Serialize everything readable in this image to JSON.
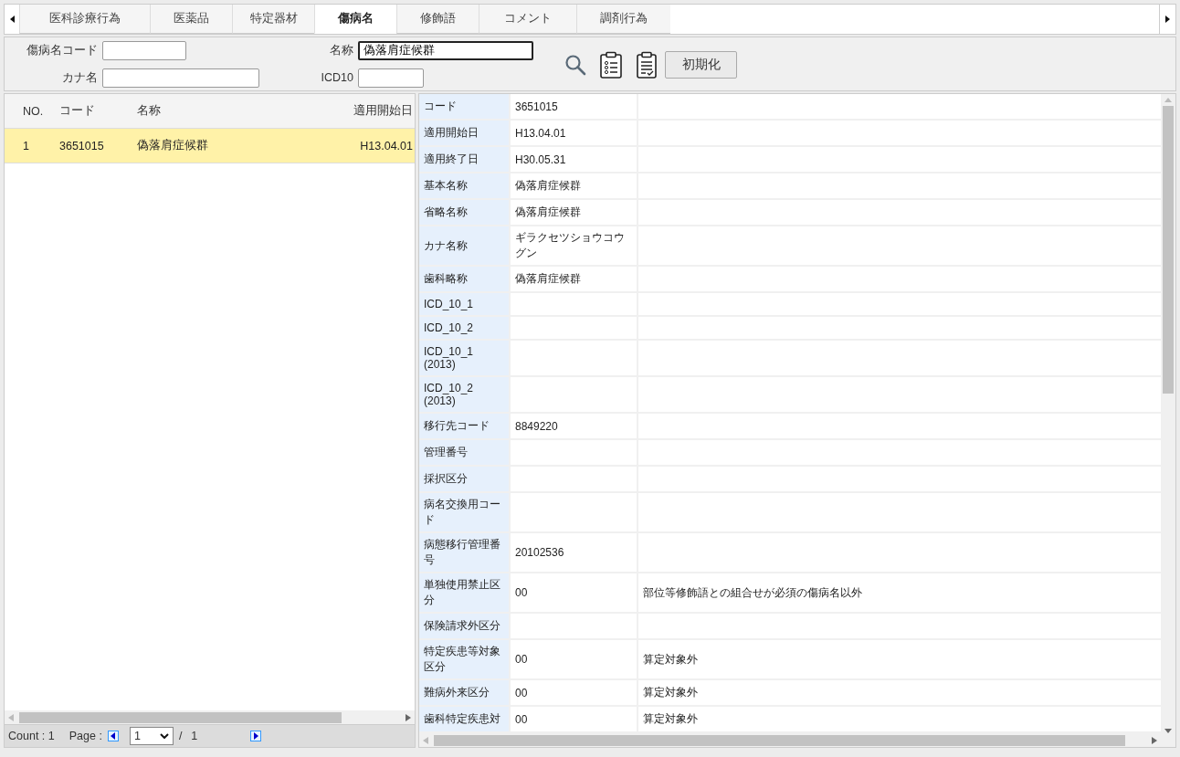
{
  "tabs": [
    {
      "label": "医科診療行為",
      "selected": false
    },
    {
      "label": "医薬品",
      "selected": false
    },
    {
      "label": "特定器材",
      "selected": false
    },
    {
      "label": "傷病名",
      "selected": true
    },
    {
      "label": "修飾語",
      "selected": false
    },
    {
      "label": "コメント",
      "selected": false
    },
    {
      "label": "調剤行為",
      "selected": false
    }
  ],
  "filters": [
    {
      "label": "傷病名コード",
      "focused": false
    },
    {
      "label": "名称",
      "value": "偽落肩症候群",
      "focused": true
    },
    {
      "label": "カナ名",
      "focused": false
    },
    {
      "label": "ICD10",
      "focused": false
    }
  ],
  "reset_button": "初期化",
  "list": {
    "columns": [
      "NO.",
      "コード",
      "名称",
      "適用開始日"
    ],
    "rows": [
      {
        "cells": [
          "1",
          "3651015",
          "偽落肩症候群",
          "H13.04.01"
        ],
        "selected": true
      }
    ]
  },
  "footer": {
    "count": "Count : 1",
    "page_label": "Page :",
    "page_select": "1",
    "separator": "/",
    "total": "1"
  },
  "detail": [
    {
      "label": "コード",
      "value": "3651015"
    },
    {
      "label": "適用開始日",
      "value": "H13.04.01"
    },
    {
      "label": "適用終了日",
      "value": "H30.05.31"
    },
    {
      "label": "基本名称",
      "value": "偽落肩症候群"
    },
    {
      "label": "省略名称",
      "value": "偽落肩症候群"
    },
    {
      "label": "カナ名称",
      "value": "ギラクセツショウコウグン"
    },
    {
      "label": "歯科略称",
      "value": "偽落肩症候群"
    },
    {
      "label": "ICD_10_1"
    },
    {
      "label": "ICD_10_2"
    },
    {
      "label": "ICD_10_1 (2013)"
    },
    {
      "label": "ICD_10_2 (2013)"
    },
    {
      "label": "移行先コード",
      "value": "8849220"
    },
    {
      "label": "管理番号"
    },
    {
      "label": "採択区分"
    },
    {
      "label": "病名交換用コード"
    },
    {
      "label": "病態移行管理番号",
      "value": "20102536"
    },
    {
      "label": "単独使用禁止区分",
      "value": "00",
      "note": "部位等修飾語との組合せが必須の傷病名以外"
    },
    {
      "label": "保険請求外区分"
    },
    {
      "label": "特定疾患等対象区分",
      "value": "00",
      "note": "算定対象外"
    },
    {
      "label": "難病外来区分",
      "value": "00",
      "note": "算定対象外"
    },
    {
      "label": "歯科特定疾患対",
      "value": "00",
      "note": "算定対象外"
    }
  ]
}
